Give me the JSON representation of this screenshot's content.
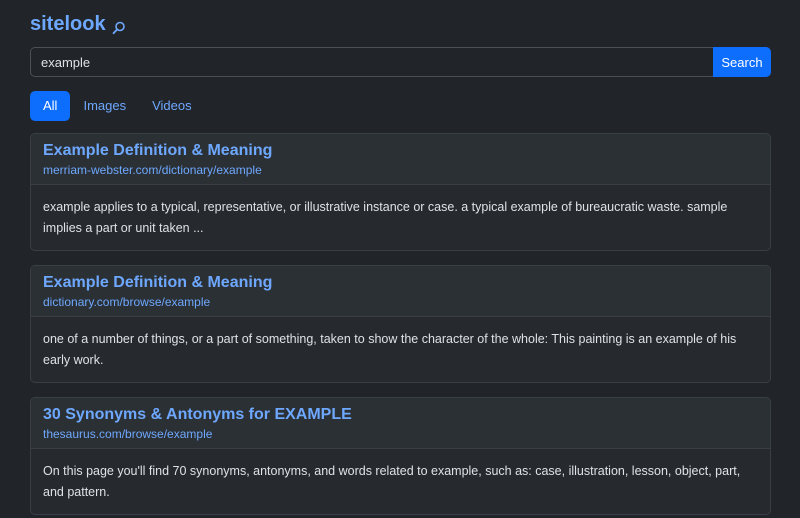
{
  "app": {
    "logo_text": "sitelook",
    "logo_icon": "search-icon"
  },
  "search": {
    "value": "example",
    "button_label": "Search"
  },
  "tabs": [
    {
      "label": "All",
      "active": true
    },
    {
      "label": "Images",
      "active": false
    },
    {
      "label": "Videos",
      "active": false
    }
  ],
  "results": [
    {
      "title": "Example Definition & Meaning",
      "url": "merriam-webster.com/dictionary/example",
      "snippet": "example applies to a typical, representative, or illustrative instance or case. a typical example of bureaucratic waste. sample implies a part or unit taken ..."
    },
    {
      "title": "Example Definition & Meaning",
      "url": "dictionary.com/browse/example",
      "snippet": "one of a number of things, or a part of something, taken to show the character of the whole: This painting is an example of his early work."
    },
    {
      "title": "30 Synonyms & Antonyms for EXAMPLE",
      "url": "thesaurus.com/browse/example",
      "snippet": "On this page you'll find 70 synonyms, antonyms, and words related to example, such as: case, illustration, lesson, object, part, and pattern."
    }
  ],
  "colors": {
    "background": "#212529",
    "accent": "#0d6efd",
    "link": "#6ea8fe"
  }
}
